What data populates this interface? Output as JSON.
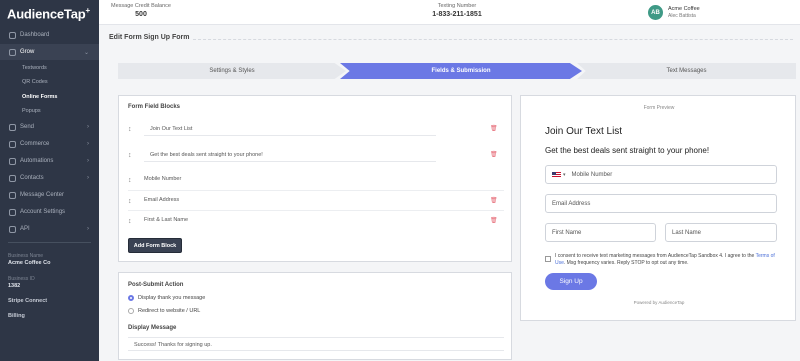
{
  "brand": {
    "logo": "AudienceTap",
    "logo_mark": "+"
  },
  "sidebar": {
    "items": [
      {
        "label": "Dashboard"
      },
      {
        "label": "Grow",
        "chevron": "⌄"
      },
      {
        "label": "Send",
        "chevron": "›"
      },
      {
        "label": "Commerce",
        "chevron": "›"
      },
      {
        "label": "Automations",
        "chevron": "›"
      },
      {
        "label": "Contacts",
        "chevron": "›"
      },
      {
        "label": "Message Center"
      },
      {
        "label": "Account Settings"
      },
      {
        "label": "API",
        "chevron": "›"
      }
    ],
    "grow_sub": [
      "Textwords",
      "QR Codes",
      "Online Forms",
      "Popups"
    ],
    "business_name_label": "Business Name",
    "business_name": "Acme Coffee Co",
    "business_id_label": "Business ID",
    "business_id": "1382",
    "stripe_connect": "Stripe Connect",
    "billing": "Billing"
  },
  "topbar": {
    "credit_label": "Message Credit Balance",
    "credit_value": "500",
    "texting_label": "Texting Number",
    "texting_value": "1-833-211-1851",
    "avatar_initials": "AB",
    "account_name": "Acme Coffee",
    "account_user": "Alec Battista"
  },
  "page": {
    "title": "Edit Form Sign Up Form"
  },
  "stepper": {
    "steps": [
      "Settings & Styles",
      "Fields & Submission",
      "Text Messages"
    ],
    "active": 1
  },
  "form_blocks": {
    "title": "Form Field Blocks",
    "rows": [
      {
        "text": "Join Our Text List",
        "deletable": true
      },
      {
        "text": "Get the best deals sent straight to your phone!",
        "deletable": true
      },
      {
        "text": "Mobile Number",
        "deletable": false
      },
      {
        "text": "Email Address",
        "deletable": true
      },
      {
        "text": "First & Last Name",
        "deletable": true
      }
    ],
    "add_button": "Add Form Block"
  },
  "post_submit": {
    "title": "Post-Submit Action",
    "options": [
      "Display thank you message",
      "Redirect to website / URL"
    ],
    "selected": 0,
    "display_message_label": "Display Message",
    "display_message_value": "Success! Thanks for signing up."
  },
  "preview": {
    "label": "Form Preview",
    "heading": "Join Our Text List",
    "subheading": "Get the best deals sent straight to your phone!",
    "mobile_placeholder": "Mobile Number",
    "email_placeholder": "Email Address",
    "first_name_placeholder": "First Name",
    "last_name_placeholder": "Last Name",
    "consent_text_1": "I consent to receive text marketing messages from AudienceTap Sandbox 4. I agree to the",
    "terms_link": "Terms of Use",
    "consent_text_2": ". Msg frequency varies. Reply STOP to opt out any time.",
    "submit_label": "Sign Up",
    "powered_by": "Powered by AudienceTap"
  },
  "colors": {
    "accent": "#6b78e5",
    "sidebar_bg": "#2e3646",
    "delete": "#e4606d",
    "avatar": "#3f9a86"
  },
  "icons": [
    "drag-handle-icon",
    "trash-icon",
    "us-flag-icon",
    "chevron-icon"
  ]
}
